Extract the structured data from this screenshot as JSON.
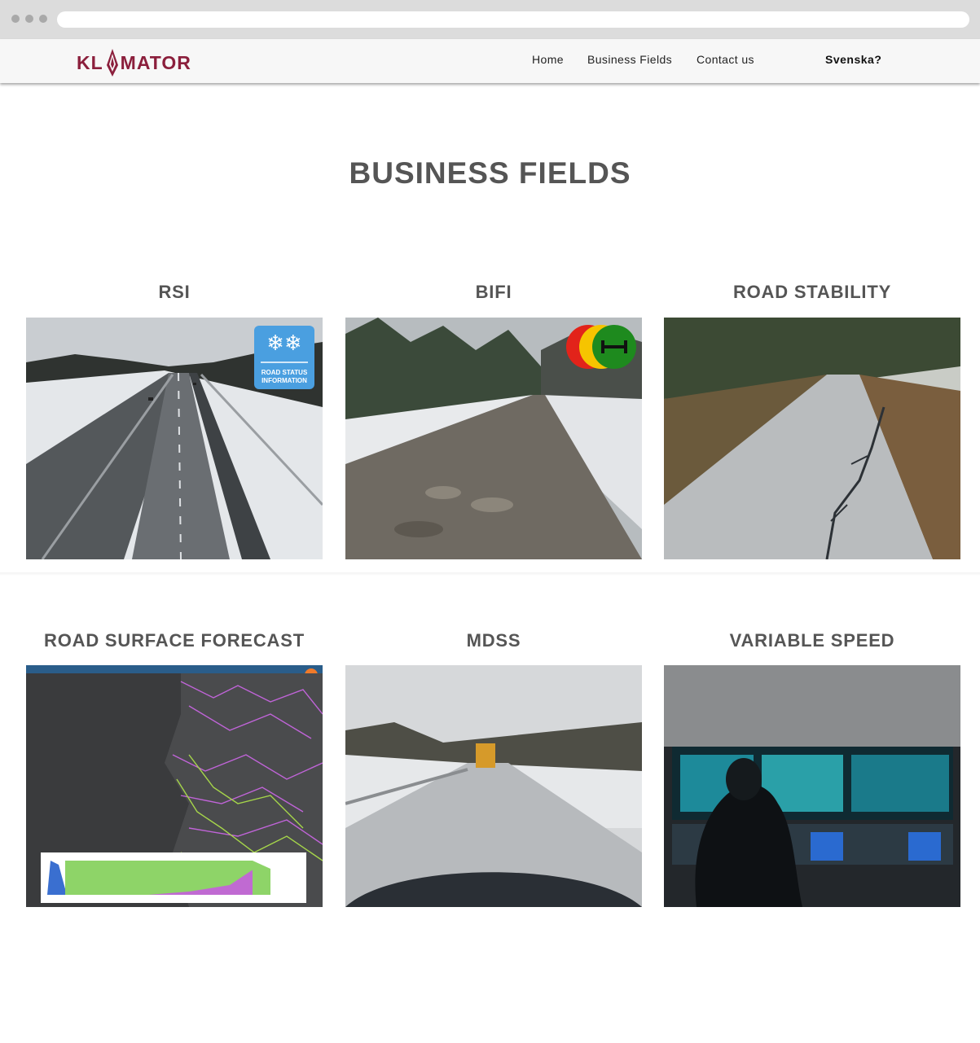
{
  "header": {
    "logo_alt": "KLIMATOR",
    "logo_left": "KL",
    "logo_right": "MATOR",
    "brand_color": "#8b1f3c",
    "nav": [
      {
        "label": "Home"
      },
      {
        "label": "Business Fields"
      },
      {
        "label": "Contact us"
      }
    ],
    "language_link": "Svenska?"
  },
  "main": {
    "title": "BUSINESS FIELDS",
    "cards": [
      {
        "title": "RSI",
        "badge_text": [
          "ROAD STATUS",
          "INFORMATION"
        ]
      },
      {
        "title": "BIFI"
      },
      {
        "title": "ROAD STABILITY"
      },
      {
        "title": "ROAD SURFACE FORECAST"
      },
      {
        "title": "MDSS"
      },
      {
        "title": "VARIABLE SPEED"
      }
    ]
  }
}
